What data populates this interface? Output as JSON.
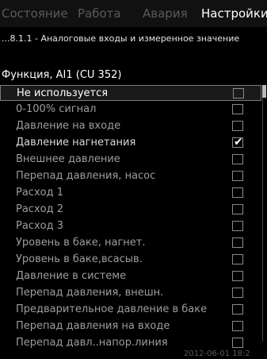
{
  "tabs": [
    {
      "label": "Состояние",
      "active": false
    },
    {
      "label": "Работа",
      "active": false
    },
    {
      "label": "Авария",
      "active": false
    },
    {
      "label": "Настройки",
      "active": true
    }
  ],
  "breadcrumb": "...8.1.1 - Аналоговые входы и измеренное значение",
  "function_title": "Функция, AI1 (CU 352)",
  "options": [
    {
      "label": "Не используется",
      "checked": false,
      "selected": true
    },
    {
      "label": "0-100% сигнал",
      "checked": false,
      "selected": false
    },
    {
      "label": "Давление на входе",
      "checked": false,
      "selected": false
    },
    {
      "label": "Давление нагнетания",
      "checked": true,
      "selected": false
    },
    {
      "label": "Внешнее давление",
      "checked": false,
      "selected": false
    },
    {
      "label": "Перепад давления, насос",
      "checked": false,
      "selected": false
    },
    {
      "label": "Расход 1",
      "checked": false,
      "selected": false
    },
    {
      "label": "Расход 2",
      "checked": false,
      "selected": false
    },
    {
      "label": "Расход 3",
      "checked": false,
      "selected": false
    },
    {
      "label": "Уровень в баке, нагнет.",
      "checked": false,
      "selected": false
    },
    {
      "label": "Уровень в баке,всасыв.",
      "checked": false,
      "selected": false
    },
    {
      "label": "Давление в системе",
      "checked": false,
      "selected": false
    },
    {
      "label": "Перепад давления, внешн.",
      "checked": false,
      "selected": false
    },
    {
      "label": "Предварительное давление в баке",
      "checked": false,
      "selected": false
    },
    {
      "label": "Перепад давления на входе",
      "checked": false,
      "selected": false
    },
    {
      "label": "Перепад давл..напор.линия",
      "checked": false,
      "selected": false
    }
  ],
  "check_mark": "✔",
  "timestamp": "2012-06-01 18:2"
}
